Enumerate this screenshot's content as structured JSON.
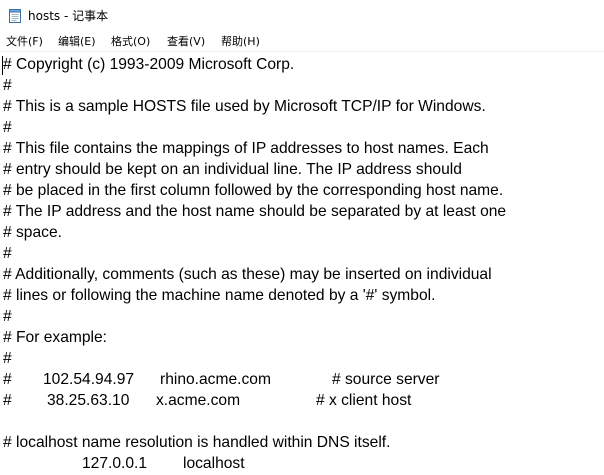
{
  "window": {
    "title": "hosts - 记事本",
    "icon": "notepad-icon"
  },
  "menu": [
    {
      "label": "文件(F)"
    },
    {
      "label": "编辑(E)"
    },
    {
      "label": "格式(O)"
    },
    {
      "label": "查看(V)"
    },
    {
      "label": "帮助(H)"
    }
  ],
  "document": {
    "lines": [
      "# Copyright (c) 1993-2009 Microsoft Corp.",
      "#",
      "# This is a sample HOSTS file used by Microsoft TCP/IP for Windows.",
      "#",
      "# This file contains the mappings of IP addresses to host names. Each",
      "# entry should be kept on an individual line. The IP address should",
      "# be placed in the first column followed by the corresponding host name.",
      "# The IP address and the host name should be separated by at least one",
      "# space.",
      "#",
      "# Additionally, comments (such as these) may be inserted on individual",
      "# lines or following the machine name denoted by a '#' symbol.",
      "#",
      "# For example:",
      "#"
    ],
    "examples": [
      {
        "hash": "#",
        "ip": "102.54.94.97",
        "host": "rhino.acme.com",
        "comment": "# source server"
      },
      {
        "hash": "#",
        "ip": "38.25.63.10",
        "host": "x.acme.com",
        "comment": "# x client host"
      }
    ],
    "localhost_comment": "# localhost name resolution is handled within DNS itself.",
    "localhost_entry": {
      "ip": "127.0.0.1",
      "host": "localhost"
    }
  }
}
